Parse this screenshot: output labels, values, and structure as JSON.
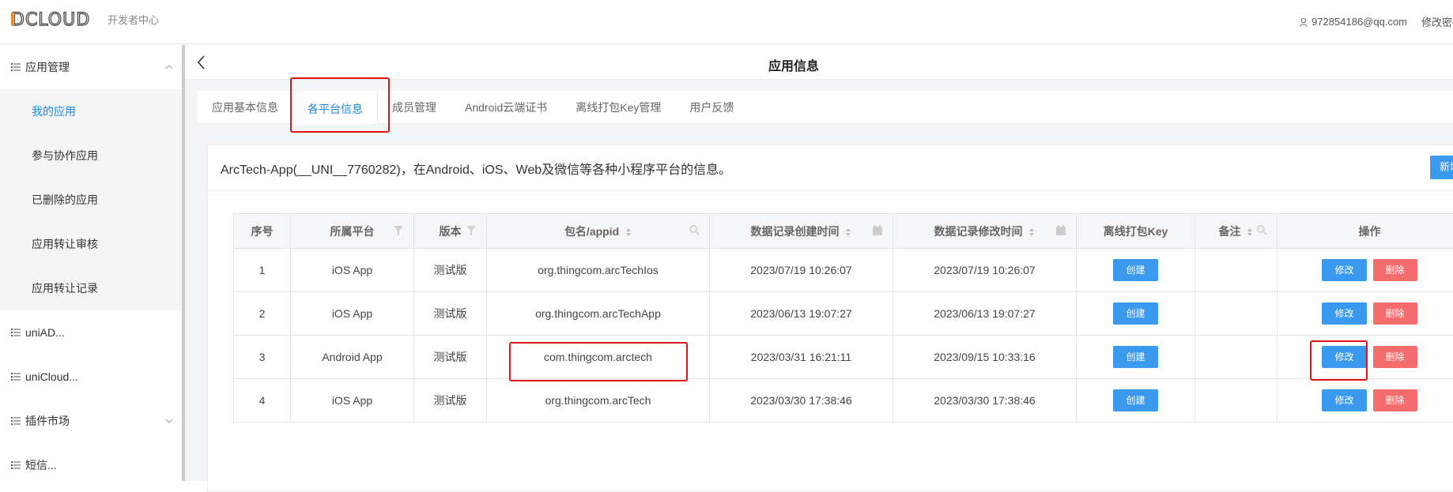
{
  "header": {
    "logo_text": "DCLOUD",
    "logo_sub": "开发者中心",
    "user_email": "972854186@qq.com",
    "change_password": "修改密码"
  },
  "sidebar": {
    "groups": [
      {
        "label": "应用管理",
        "expanded": true,
        "items": [
          {
            "label": "我的应用",
            "active": true
          },
          {
            "label": "参与协作应用"
          },
          {
            "label": "已删除的应用"
          },
          {
            "label": "应用转让审核"
          },
          {
            "label": "应用转让记录"
          }
        ]
      },
      {
        "label": "uniAD..."
      },
      {
        "label": "uniCloud..."
      },
      {
        "label": "插件市场"
      },
      {
        "label": "短信..."
      }
    ]
  },
  "page": {
    "title": "应用信息"
  },
  "tabs": [
    {
      "label": "应用基本信息"
    },
    {
      "label": "各平台信息",
      "active": true
    },
    {
      "label": "成员管理"
    },
    {
      "label": "Android云端证书"
    },
    {
      "label": "离线打包Key管理"
    },
    {
      "label": "用户反馈"
    }
  ],
  "panel": {
    "description": "ArcTech-App(__UNI__7760282)，在Android、iOS、Web及微信等各种小程序平台的信息。",
    "new_button": "新增"
  },
  "table": {
    "headers": [
      "序号",
      "所属平台",
      "版本",
      "包名/appid",
      "数据记录创建时间",
      "数据记录修改时间",
      "离线打包Key",
      "备注",
      "操作"
    ],
    "rows": [
      {
        "index": "1",
        "platform": "iOS App",
        "version": "测试版",
        "package": "org.thingcom.arcTechIos",
        "created": "2023/07/19 10:26:07",
        "modified": "2023/07/19 10:26:07",
        "key_btn": "创建",
        "note": "",
        "edit": "修改",
        "delete": "删除"
      },
      {
        "index": "2",
        "platform": "iOS App",
        "version": "测试版",
        "package": "org.thingcom.arcTechApp",
        "created": "2023/06/13 19:07:27",
        "modified": "2023/06/13 19:07:27",
        "key_btn": "创建",
        "note": "",
        "edit": "修改",
        "delete": "删除"
      },
      {
        "index": "3",
        "platform": "Android App",
        "version": "测试版",
        "package": "com.thingcom.arctech",
        "created": "2023/03/31 16:21:11",
        "modified": "2023/09/15 10:33:16",
        "key_btn": "创建",
        "note": "",
        "edit": "修改",
        "delete": "删除"
      },
      {
        "index": "4",
        "platform": "iOS App",
        "version": "测试版",
        "package": "org.thingcom.arcTech",
        "created": "2023/03/30 17:38:46",
        "modified": "2023/03/30 17:38:46",
        "key_btn": "创建",
        "note": "",
        "edit": "修改",
        "delete": "删除"
      }
    ]
  },
  "colors": {
    "accent": "#1a88e6",
    "button_blue": "#3a9af0",
    "button_red": "#f56c6c",
    "annotation": "#e01414"
  }
}
